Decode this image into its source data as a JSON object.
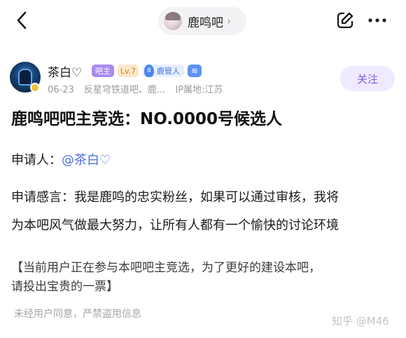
{
  "topbar": {
    "forum_name": "鹿鸣吧",
    "chevron": "›",
    "icons": [
      "back-chevron-icon",
      "edit-icon",
      "more-dots-icon"
    ]
  },
  "author": {
    "name": "茶白♡",
    "badge_owner": "吧主",
    "badge_level": "Lv.7",
    "badge_manager_num": "8",
    "badge_manager": "鹿管人",
    "badge_wave": "≋",
    "date": "06-23",
    "source": "反星穹铁道吧、鹿...",
    "ip": "IP属地:江苏"
  },
  "follow_label": "关注",
  "post": {
    "title": "鹿鸣吧吧主竞选：NO.0000号候选人",
    "applicant_label": "申请人：",
    "applicant_name": "@茶白♡",
    "speech_line1": "申请感言：我是鹿鸣的忠实粉丝，如果可以通过审核，我将",
    "speech_line2": "为本吧风气做最大努力，让所有人都有一个愉快的讨论环境",
    "notice_line1": "【当前用户正在参与本吧吧主竞选，为了更好的建设本吧，",
    "notice_line2": "请投出宝贵的一票】",
    "disclaimer": "未经用户同意，严禁盗用信息"
  },
  "watermark": "知乎 @M46",
  "colors": {
    "accent_purple": "#7a5fe0",
    "mention_blue": "#4a6fe0",
    "owner_badge": "#a98bf0"
  }
}
